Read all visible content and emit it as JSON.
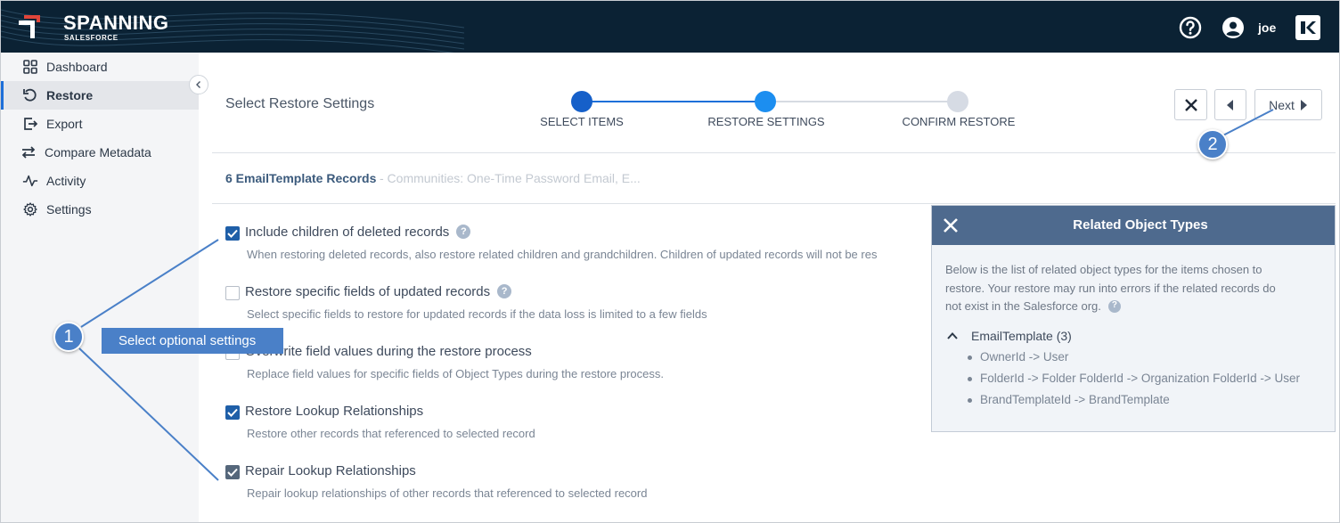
{
  "header": {
    "brand": "SPANNING",
    "brand_sub": "SALESFORCE",
    "user": "joe"
  },
  "sidebar": {
    "items": [
      {
        "label": "Dashboard",
        "icon": "grid-icon"
      },
      {
        "label": "Restore",
        "icon": "restore-icon"
      },
      {
        "label": "Export",
        "icon": "export-icon"
      },
      {
        "label": "Compare Metadata",
        "icon": "compare-icon"
      },
      {
        "label": "Activity",
        "icon": "activity-icon"
      },
      {
        "label": "Settings",
        "icon": "gear-icon"
      }
    ],
    "active": "Restore"
  },
  "main": {
    "title": "Select Restore Settings",
    "steps": [
      {
        "label": "SELECT ITEMS",
        "state": "done"
      },
      {
        "label": "RESTORE SETTINGS",
        "state": "current"
      },
      {
        "label": "CONFIRM RESTORE",
        "state": "pending"
      }
    ],
    "toolbar": {
      "next_label": "Next"
    },
    "records": {
      "title": "6 EmailTemplate Records",
      "desc": "- Communities: One-Time Password Email, E..."
    },
    "options": [
      {
        "label": "Include children of deleted records",
        "desc": "When restoring deleted records, also restore related children and grandchildren. Children of updated records will not be res",
        "checked": true,
        "help": true
      },
      {
        "label": "Restore specific fields of updated records",
        "desc": "Select specific fields to restore for updated records if the data loss is limited to a few fields",
        "checked": false,
        "help": true
      },
      {
        "label": "Overwrite field values during the restore process",
        "desc": "Replace field values for specific fields of Object Types during the restore process.",
        "checked": false,
        "help": false
      },
      {
        "label": "Restore Lookup Relationships",
        "desc": "Restore other records that referenced to selected record",
        "checked": true,
        "help": false
      },
      {
        "label": "Repair Lookup Relationships",
        "desc": "Repair lookup relationships of other records that referenced to selected record",
        "checked": true,
        "help": false
      }
    ]
  },
  "panel": {
    "title": "Related Object Types",
    "text": "Below is the list of related object types for the items chosen to restore. Your restore may run into errors if the related records do not exist in the Salesforce org.",
    "group": "EmailTemplate (3)",
    "items": [
      "OwnerId -> User",
      "FolderId -> Folder FolderId -> Organization FolderId -> User",
      "BrandTemplateId -> BrandTemplate"
    ]
  },
  "annotations": {
    "n1": "1",
    "n2": "2",
    "label1": "Select optional settings"
  },
  "colors": {
    "header_bg": "#0b2234",
    "accent": "#1e6fd9",
    "panel_header": "#4e6a8e",
    "annotation": "#4a80c8"
  }
}
